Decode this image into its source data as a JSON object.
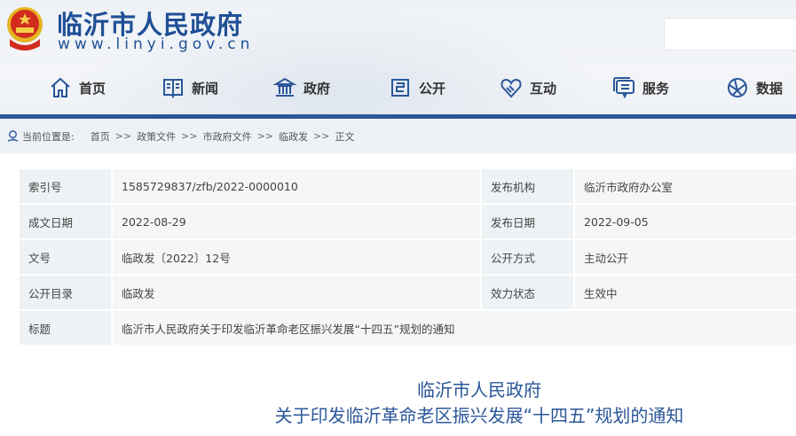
{
  "header": {
    "title": "临沂市人民政府",
    "url": "www.linyi.gov.cn"
  },
  "nav": [
    {
      "label": "首页",
      "icon": "home-icon"
    },
    {
      "label": "新闻",
      "icon": "news-icon"
    },
    {
      "label": "政府",
      "icon": "government-icon"
    },
    {
      "label": "公开",
      "icon": "disclosure-icon"
    },
    {
      "label": "互动",
      "icon": "handshake-icon"
    },
    {
      "label": "服务",
      "icon": "service-icon"
    },
    {
      "label": "数据",
      "icon": "data-icon"
    }
  ],
  "breadcrumb": {
    "prefix": "当前位置是:",
    "items": [
      "首页",
      "政策文件",
      "市政府文件",
      "临政发",
      "正文"
    ],
    "sep": ">>"
  },
  "info": {
    "rows": [
      {
        "l1": "索引号",
        "v1": "1585729837/zfb/2022-0000010",
        "l2": "发布机构",
        "v2": "临沂市政府办公室"
      },
      {
        "l1": "成文日期",
        "v1": "2022-08-29",
        "l2": "发布日期",
        "v2": "2022-09-05"
      },
      {
        "l1": "文号",
        "v1": "临政发〔2022〕12号",
        "l2": "公开方式",
        "v2": "主动公开"
      },
      {
        "l1": "公开目录",
        "v1": "临政发",
        "l2": "效力状态",
        "v2": "生效中"
      }
    ],
    "title_label": "标题",
    "title_value": "临沂市人民政府关于印发临沂革命老区振兴发展“十四五”规划的通知"
  },
  "doc": {
    "line1": "临沂市人民政府",
    "line2": "关于印发临沂革命老区振兴发展“十四五”规划的通知"
  }
}
